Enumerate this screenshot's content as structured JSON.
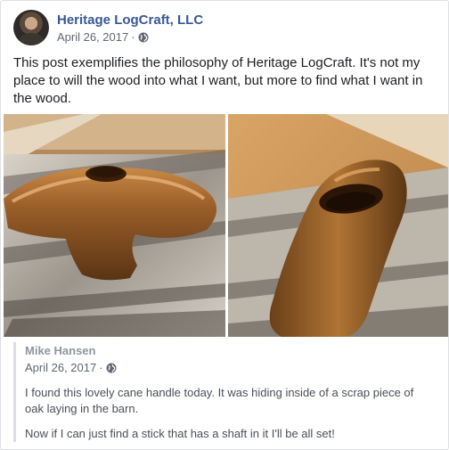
{
  "post": {
    "page_name": "Heritage LogCraft, LLC",
    "date": "April 26, 2017",
    "separator": "·",
    "privacy_icon": "globe-icon",
    "text": "This post exemplifies the philosophy of Heritage LogCraft. It's not my place to will the wood into what I want, but more to find what I want in the wood."
  },
  "photos": [
    {
      "subject": "oak-cane-handle-side-view"
    },
    {
      "subject": "oak-cane-handle-end-view"
    }
  ],
  "shared_post": {
    "author": "Mike Hansen",
    "date": "April 26, 2017",
    "separator": "·",
    "privacy_icon": "globe-icon",
    "paragraph_1": "I found this lovely cane handle today. It was hiding inside of a scrap piece of oak laying in the barn.",
    "paragraph_2": "Now if I can just find a stick that has a shaft in it I'll be all set!"
  },
  "colors": {
    "link": "#385898",
    "meta": "#616770",
    "border": "#dddfe2",
    "wood": "#8a5a2b"
  }
}
